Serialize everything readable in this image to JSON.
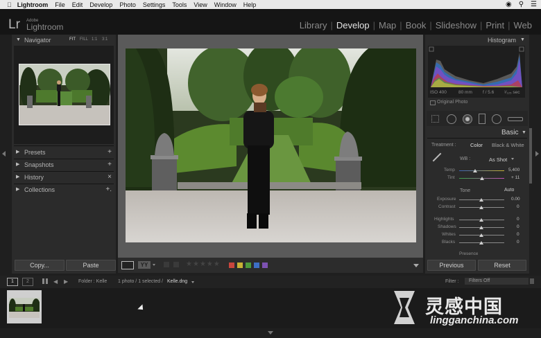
{
  "menubar": {
    "app": "Lightroom",
    "items": [
      "File",
      "Edit",
      "Develop",
      "Photo",
      "Settings",
      "Tools",
      "View",
      "Window",
      "Help"
    ]
  },
  "identity": {
    "adobe": "Adobe",
    "name": "Lightroom",
    "logo": "Lr"
  },
  "modules": [
    "Library",
    "Develop",
    "Map",
    "Book",
    "Slideshow",
    "Print",
    "Web"
  ],
  "active_module": "Develop",
  "left": {
    "navigator": {
      "title": "Navigator",
      "zoom": [
        "FIT",
        "FILL",
        "1:1",
        "3:1"
      ]
    },
    "sections": [
      {
        "label": "Presets",
        "action": "+"
      },
      {
        "label": "Snapshots",
        "action": "+"
      },
      {
        "label": "History",
        "action": "×"
      },
      {
        "label": "Collections",
        "action": "+."
      }
    ],
    "copy": "Copy...",
    "paste": "Paste"
  },
  "right": {
    "histogram": {
      "title": "Histogram",
      "iso": "ISO 400",
      "focal": "80 mm",
      "aperture": "f / 5.6",
      "shutter": "¹⁄₁₂₅ sec",
      "original_label": "Original Photo"
    },
    "basic": {
      "title": "Basic",
      "treatment_label": "Treatment :",
      "treatment_color": "Color",
      "treatment_bw": "Black & White",
      "wb_label": "WB :",
      "wb_value": "As Shot",
      "temp_label": "Temp",
      "temp_value": "5,400",
      "tint_label": "Tint",
      "tint_value": "+ 11",
      "tone_label": "Tone",
      "auto_label": "Auto",
      "exposure_label": "Exposure",
      "exposure_value": "0.00",
      "contrast_label": "Contrast",
      "contrast_value": "0",
      "highlights_label": "Highlights",
      "highlights_value": "0",
      "shadows_label": "Shadows",
      "shadows_value": "0",
      "whites_label": "Whites",
      "whites_value": "0",
      "blacks_label": "Blacks",
      "blacks_value": "0",
      "presence_label": "Presence"
    },
    "previous": "Previous",
    "reset": "Reset"
  },
  "filmstrip_bar": {
    "page1": "1",
    "page2": "2",
    "folder": "Folder : Kelle",
    "count": "1 photo / 1 selected /",
    "filename": "Kelle.dng",
    "filter_label": "Filter :",
    "filter_value": "Filters Off"
  },
  "watermark": {
    "brand": "灵感中国",
    "url": "lingganchina.com"
  },
  "colors": {
    "label_red": "#c9463d",
    "label_yellow": "#c8b235",
    "label_green": "#4c9a3b",
    "label_blue": "#3d6fc4",
    "label_purple": "#7d52b2"
  }
}
